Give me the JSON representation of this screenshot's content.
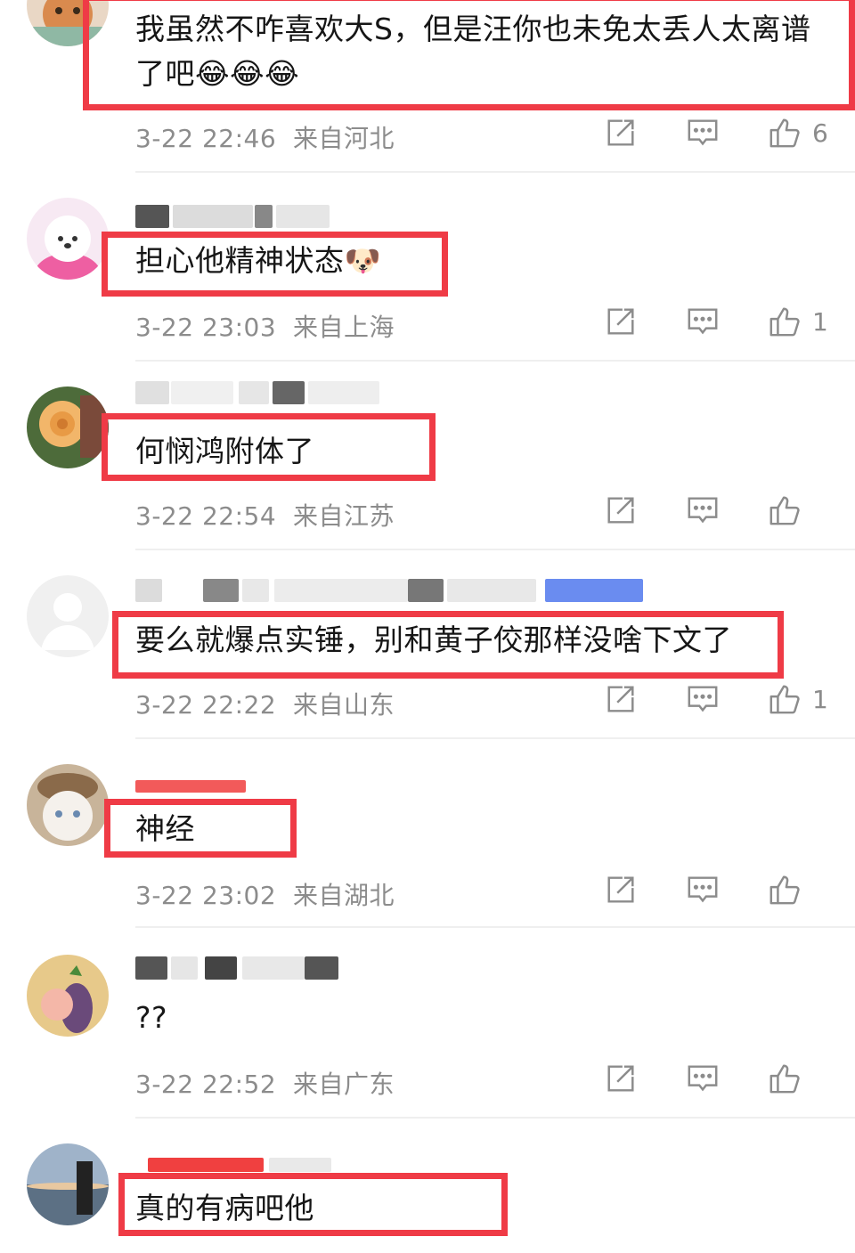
{
  "colors": {
    "highlight": "#ef3b46",
    "meta_gray": "#8c8c8c",
    "divider": "#efefef"
  },
  "comments": [
    {
      "text": "我虽然不咋喜欢大S，但是汪你也未免太丢人太离谱了吧😂😂😂",
      "time": "3-22 22:46",
      "location": "来自河北",
      "likes": "6"
    },
    {
      "text": "担心他精神状态🐶",
      "time": "3-22 23:03",
      "location": "来自上海",
      "likes": "1"
    },
    {
      "text": "何悯鸿附体了",
      "time": "3-22 22:54",
      "location": "来自江苏",
      "likes": ""
    },
    {
      "text": "要么就爆点实锤，别和黄子佼那样没啥下文了",
      "time": "3-22 22:22",
      "location": "来自山东",
      "likes": "1"
    },
    {
      "text": "神经",
      "time": "3-22 23:02",
      "location": "来自湖北",
      "likes": ""
    },
    {
      "text": "??",
      "time": "3-22 22:52",
      "location": "来自广东",
      "likes": ""
    },
    {
      "text": "真的有病吧他",
      "time": "",
      "location": "",
      "likes": ""
    }
  ],
  "icons": {
    "share": "share-icon",
    "reply": "comment-icon",
    "like": "thumbs-up-icon"
  }
}
